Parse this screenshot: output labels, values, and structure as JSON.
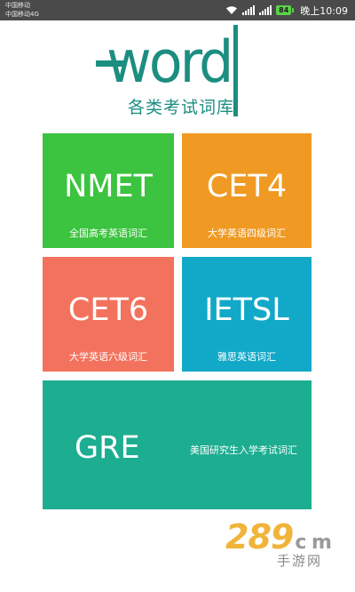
{
  "status_bar": {
    "carrier_1": "中国移动",
    "carrier_2": "中国移动4G",
    "network_label": "4G",
    "battery": "84",
    "time": "晚上10:09",
    "icons": [
      "wifi-icon",
      "signal-icon",
      "signal-icon",
      "battery-icon"
    ]
  },
  "logo": {
    "wordmark": "word",
    "subtitle": "各类考试词库",
    "color": "#1c8e80"
  },
  "tiles": [
    {
      "title": "NMET",
      "subtitle": "全国高考英语词汇",
      "color": "#3cc33f"
    },
    {
      "title": "CET4",
      "subtitle": "大学英语四级词汇",
      "color": "#f09a23"
    },
    {
      "title": "CET6",
      "subtitle": "大学英语六级词汇",
      "color": "#f3725d"
    },
    {
      "title": "IETSL",
      "subtitle": "雅思英语词汇",
      "color": "#12a9c9"
    },
    {
      "title": "GRE",
      "subtitle": "美国研究生入学考试词汇",
      "color": "#1dad91"
    }
  ],
  "watermark": {
    "brand": "289",
    "domain": "c m",
    "sub": "手游网"
  }
}
